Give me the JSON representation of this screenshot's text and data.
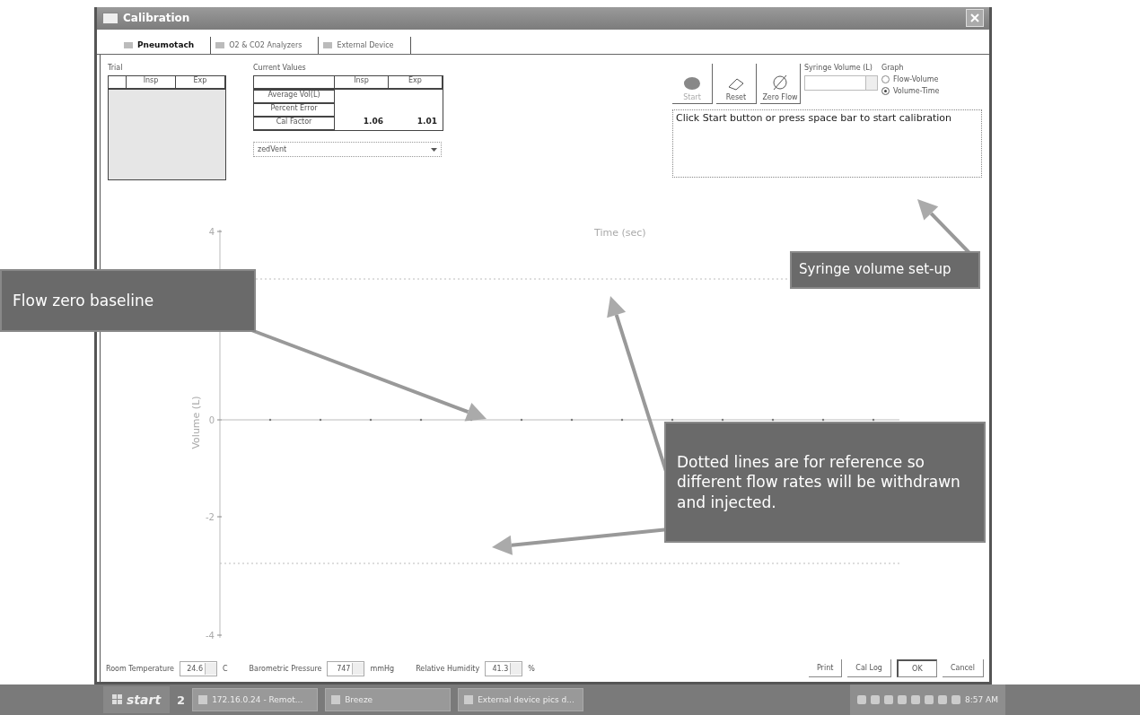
{
  "window": {
    "title": "Calibration"
  },
  "tabs": [
    {
      "label": "Pneumotach",
      "selected": true
    },
    {
      "label": "O2 & CO2 Analyzers",
      "selected": false
    },
    {
      "label": "External Device",
      "selected": false
    }
  ],
  "trial": {
    "title": "Trial",
    "columns": [
      "Insp",
      "Exp"
    ]
  },
  "current_values": {
    "title": "Current Values",
    "columns": [
      "Insp",
      "Exp"
    ],
    "rows": [
      {
        "label": "Average Vol(L)"
      },
      {
        "label": "Percent Error"
      },
      {
        "label": "Cal Factor",
        "insp": "1.06",
        "exp": "1.01"
      }
    ],
    "dropdown": {
      "value": "zedVent"
    }
  },
  "toolbar": [
    {
      "kind": "start",
      "label": "Start",
      "disabled": true
    },
    {
      "kind": "reset",
      "label": "Reset",
      "disabled": false
    },
    {
      "kind": "zero",
      "label": "Zero Flow",
      "disabled": false
    }
  ],
  "syringe": {
    "label": "Syringe Volume (L)"
  },
  "graph": {
    "title": "Graph",
    "options": [
      {
        "label": "Flow-Volume",
        "selected": false
      },
      {
        "label": "Volume-Time",
        "selected": true
      }
    ]
  },
  "message": "Click Start button or press space bar to start calibration",
  "chart": {
    "title": "Time (sec)",
    "ylabel": "Volume (L)",
    "ytick_labels": [
      "4",
      "0",
      "-2",
      "-4"
    ]
  },
  "conditions": [
    {
      "label": "Room Temperature",
      "value": "24.6",
      "unit": "C"
    },
    {
      "label": "Barometric Pressure",
      "value": "747",
      "unit": "mmHg"
    },
    {
      "label": "Relative Humidity",
      "value": "41.3",
      "unit": "%"
    }
  ],
  "buttons": [
    {
      "label": "Print",
      "default": false
    },
    {
      "label": "Cal Log",
      "default": false
    },
    {
      "label": "OK",
      "default": true
    },
    {
      "label": "Cancel",
      "default": false
    }
  ],
  "callouts": [
    {
      "text": "Syringe volume set-up"
    },
    {
      "text": "Flow zero baseline"
    },
    {
      "text": "Dotted lines are for reference so different flow rates will be withdrawn and injected."
    }
  ],
  "taskbar": {
    "start": "start",
    "badge": "2",
    "tasks": [
      "172.16.0.24 - Remot...",
      "Breeze",
      "External device pics d..."
    ],
    "clock": "8:57 AM"
  }
}
